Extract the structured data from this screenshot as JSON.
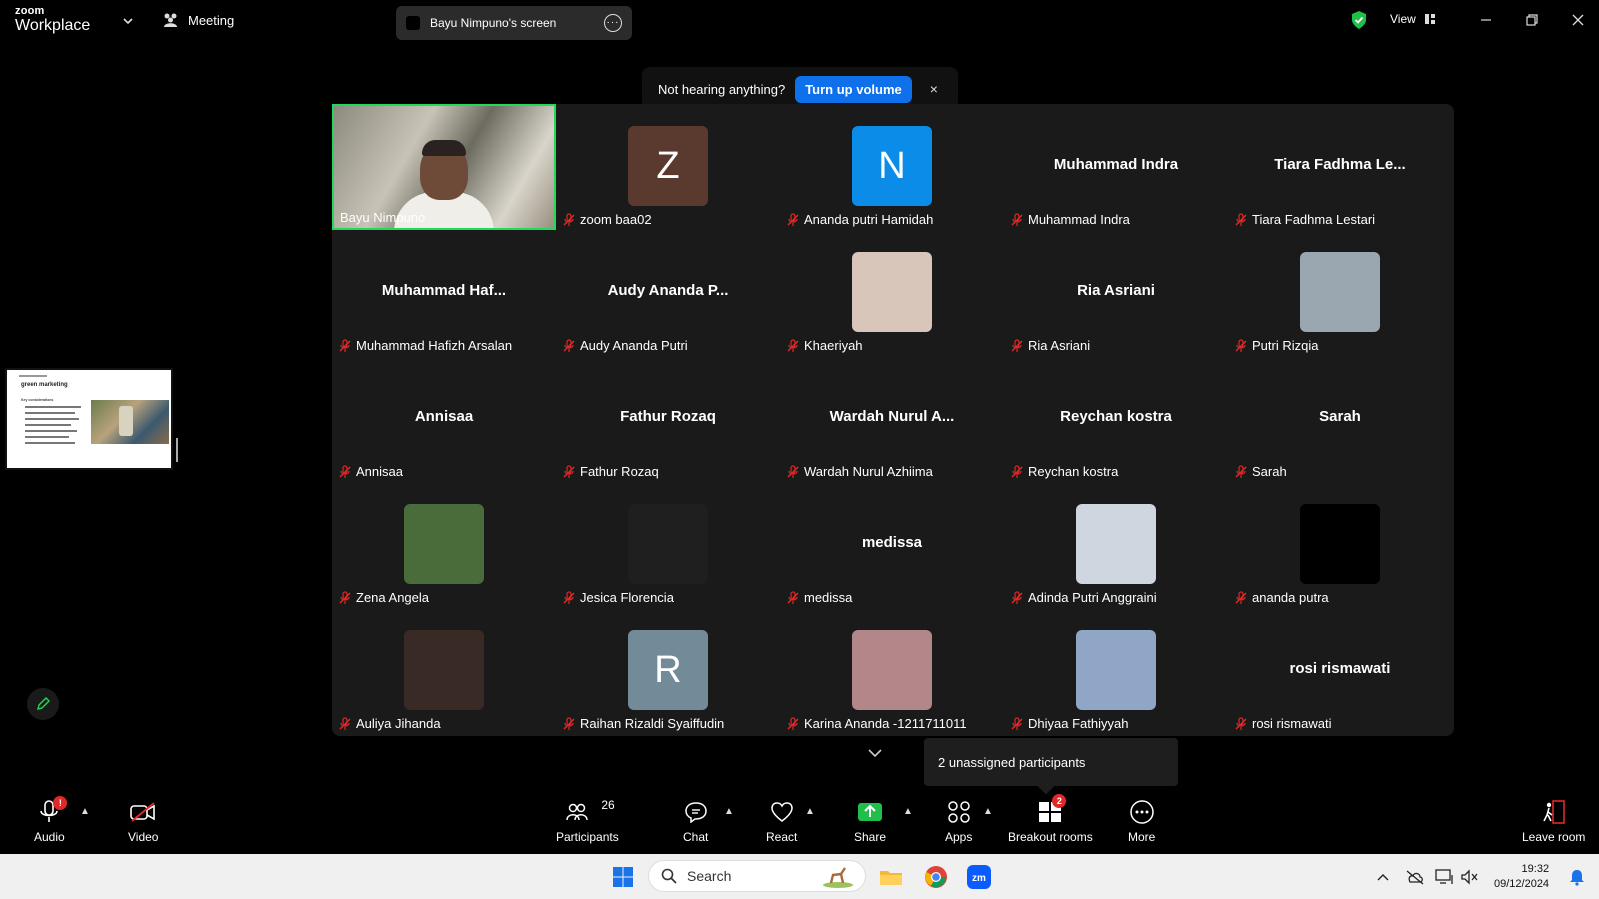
{
  "titlebar": {
    "brand_top": "zoom",
    "brand_bottom": "Workplace",
    "meeting_label": "Meeting",
    "shared_screen": "Bayu Nimpuno's screen",
    "view_label": "View"
  },
  "notification": {
    "text": "Not hearing anything?",
    "button": "Turn up volume",
    "close": "×"
  },
  "share_thumbnail": {
    "title": "green marketing",
    "subtitle": "Key considerations"
  },
  "participants": [
    {
      "display": "video",
      "name": "Bayu Nimpuno",
      "muted": false,
      "active": true
    },
    {
      "display": "avatar",
      "initial": "Z",
      "color": "#5a3a2e",
      "name": "zoom baa02",
      "muted": true
    },
    {
      "display": "avatar",
      "initial": "N",
      "color": "#0b8ce9",
      "name": "Ananda putri Hamidah",
      "muted": true
    },
    {
      "display": "text",
      "big": "Muhammad Indra",
      "name": "Muhammad Indra",
      "muted": true
    },
    {
      "display": "text",
      "big": "Tiara Fadhma Le...",
      "name": "Tiara Fadhma Lestari",
      "muted": true
    },
    {
      "display": "text",
      "big": "Muhammad  Haf...",
      "name": "Muhammad Hafizh Arsalan",
      "muted": true
    },
    {
      "display": "text",
      "big": "Audy  Ananda  P...",
      "name": "Audy Ananda Putri",
      "muted": true
    },
    {
      "display": "photo",
      "color": "#d8c6bb",
      "name": "Khaeriyah",
      "muted": true
    },
    {
      "display": "text",
      "big": "Ria Asriani",
      "name": "Ria Asriani",
      "muted": true
    },
    {
      "display": "photo",
      "color": "#9aa6b0",
      "name": "Putri Rizqia",
      "muted": true
    },
    {
      "display": "text",
      "big": "Annisaa",
      "name": "Annisaa",
      "muted": true
    },
    {
      "display": "text",
      "big": "Fathur Rozaq",
      "name": "Fathur Rozaq",
      "muted": true
    },
    {
      "display": "text",
      "big": "Wardah  Nurul  A...",
      "name": "Wardah Nurul Azhiima",
      "muted": true
    },
    {
      "display": "text",
      "big": "Reychan kostra",
      "name": "Reychan kostra",
      "muted": true
    },
    {
      "display": "text",
      "big": "Sarah",
      "name": "Sarah",
      "muted": true
    },
    {
      "display": "photo",
      "color": "#4a6b3a",
      "name": "Zena Angela",
      "muted": true
    },
    {
      "display": "photo",
      "color": "#1f1f1f",
      "name": "Jesica Florencia",
      "muted": true
    },
    {
      "display": "text",
      "big": "medissa",
      "name": "medissa",
      "muted": true
    },
    {
      "display": "photo",
      "color": "#cfd6e0",
      "name": "Adinda Putri Anggraini",
      "muted": true
    },
    {
      "display": "photo",
      "color": "#000000",
      "name": "ananda putra",
      "muted": true
    },
    {
      "display": "photo",
      "color": "#3a2a25",
      "name": "Auliya Jihanda",
      "muted": true
    },
    {
      "display": "avatar",
      "initial": "R",
      "color": "#738a99",
      "name": "Raihan Rizaldi Syaiffudin",
      "muted": true
    },
    {
      "display": "photo",
      "color": "#b3868a",
      "name": "Karina Ananda -1211711011",
      "muted": true
    },
    {
      "display": "photo",
      "color": "#8fa6c6",
      "name": "Dhiyaa Fathiyyah",
      "muted": true
    },
    {
      "display": "text",
      "big": "rosi rismawati",
      "name": "rosi rismawati",
      "muted": true
    }
  ],
  "unassigned_text": "2 unassigned participants",
  "toolbar": {
    "audio": "Audio",
    "video": "Video",
    "participants": "Participants",
    "participants_count": "26",
    "chat": "Chat",
    "react": "React",
    "share": "Share",
    "apps": "Apps",
    "breakout": "Breakout rooms",
    "breakout_badge": "2",
    "audio_badge": "!",
    "more": "More",
    "leave": "Leave room"
  },
  "taskbar": {
    "search_placeholder": "Search",
    "time": "19:32",
    "date": "09/12/2024"
  },
  "colors": {
    "accent_blue": "#0e71eb",
    "active_speaker": "#23d959",
    "share_green": "#1fbf4a",
    "muted_red": "#e02828"
  }
}
